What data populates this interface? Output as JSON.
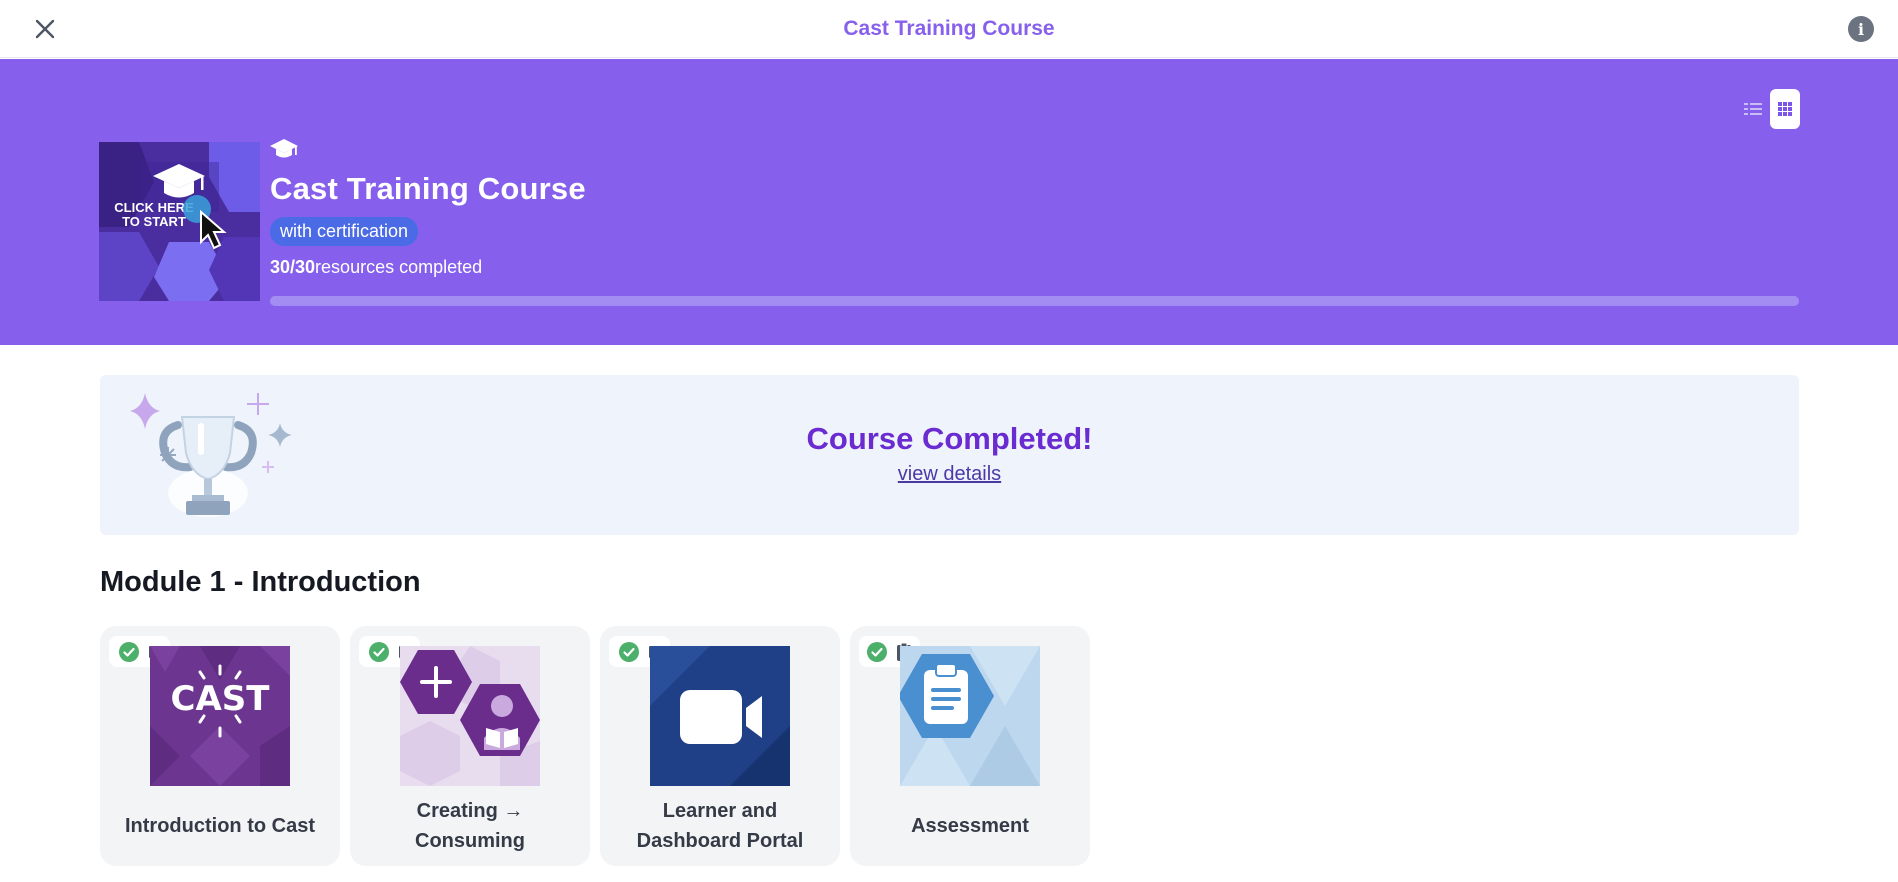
{
  "topbar": {
    "title": "Cast Training Course",
    "close_icon": "close-icon",
    "info_icon": "info-icon"
  },
  "hero": {
    "thumbnail": {
      "line1": "CLICK HERE",
      "line2": "TO START"
    },
    "title": "Cast Training Course",
    "badge": "with certification",
    "progress_count": "30/30",
    "progress_label": "resources completed",
    "progress_fraction": 1.0,
    "view_modes": [
      "list",
      "grid"
    ],
    "active_view": "grid"
  },
  "completed": {
    "title": "Course Completed!",
    "link": "view details"
  },
  "module": {
    "title": "Module 1 - Introduction",
    "cards": [
      {
        "title_line1": "Introduction to Cast",
        "title_line2": "",
        "type_icon": "play-icon",
        "status_icon": "check-circle-icon",
        "thumb_text": "CAST"
      },
      {
        "title_line1": "Creating →",
        "title_line2": "Consuming",
        "type_icon": "play-icon",
        "status_icon": "check-circle-icon"
      },
      {
        "title_line1": "Learner and",
        "title_line2": "Dashboard Portal",
        "type_icon": "play-icon",
        "status_icon": "check-circle-icon"
      },
      {
        "title_line1": "Assessment",
        "title_line2": "",
        "type_icon": "clipboard-icon",
        "status_icon": "check-circle-icon"
      }
    ]
  },
  "colors": {
    "brand_purple": "#8660ed",
    "title_purple": "#8760ec",
    "completed_purple": "#6a2bd0",
    "badge_blue": "#4b6be6",
    "check_green": "#4caf6a"
  }
}
